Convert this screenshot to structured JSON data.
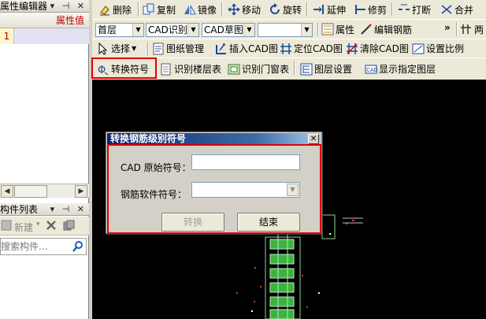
{
  "left_panel": {
    "title": "属性编辑器",
    "title_icons": "▾ ⊣ ✕",
    "grid_header": "属性值",
    "row_number": "1",
    "component_list_title": "构件列表",
    "component_list_icons": "▾ ⊣ ✕",
    "new_label": "新建",
    "search_placeholder": "搜索构件..."
  },
  "toolbar1": {
    "delete": "删除",
    "copy": "复制",
    "mirror": "镜像",
    "move": "移动",
    "rotate": "旋转",
    "extend": "延伸",
    "trim": "修剪",
    "break": "打断",
    "merge": "合并"
  },
  "toolbar2": {
    "floor_combo": "首层",
    "cad_recognize_combo": "CAD识别",
    "cad_draft_combo": "CAD草图",
    "empty_combo": "",
    "properties": "属性",
    "edit_rebar": "编辑钢筋",
    "more": "»",
    "last_item": "两"
  },
  "toolbar3": {
    "select": "选择",
    "drawing_manage": "图纸管理",
    "insert_cad": "插入CAD图",
    "locate_cad": "定位CAD图",
    "clear_cad": "清除CAD图",
    "set_scale": "设置比例"
  },
  "toolbar4": {
    "convert_symbol": "转换符号",
    "recognize_floor_table": "识别楼层表",
    "recognize_door_window_table": "识别门窗表",
    "layer_settings": "图层设置",
    "show_specified_layer": "显示指定图层"
  },
  "dialog": {
    "title": "转换钢筋级别符号",
    "close": "✕",
    "cad_original_label": "CAD 原始符号：",
    "cad_original_value": "",
    "software_symbol_label": "钢筋软件符号：",
    "software_symbol_value": "",
    "convert_button": "转换",
    "finish_button": "结束"
  },
  "colors": {
    "highlight_red": "#e00000",
    "dialog_title_start": "#0a246a",
    "canvas_bg": "#000000",
    "toolbar_bg": "#ece9d8"
  }
}
